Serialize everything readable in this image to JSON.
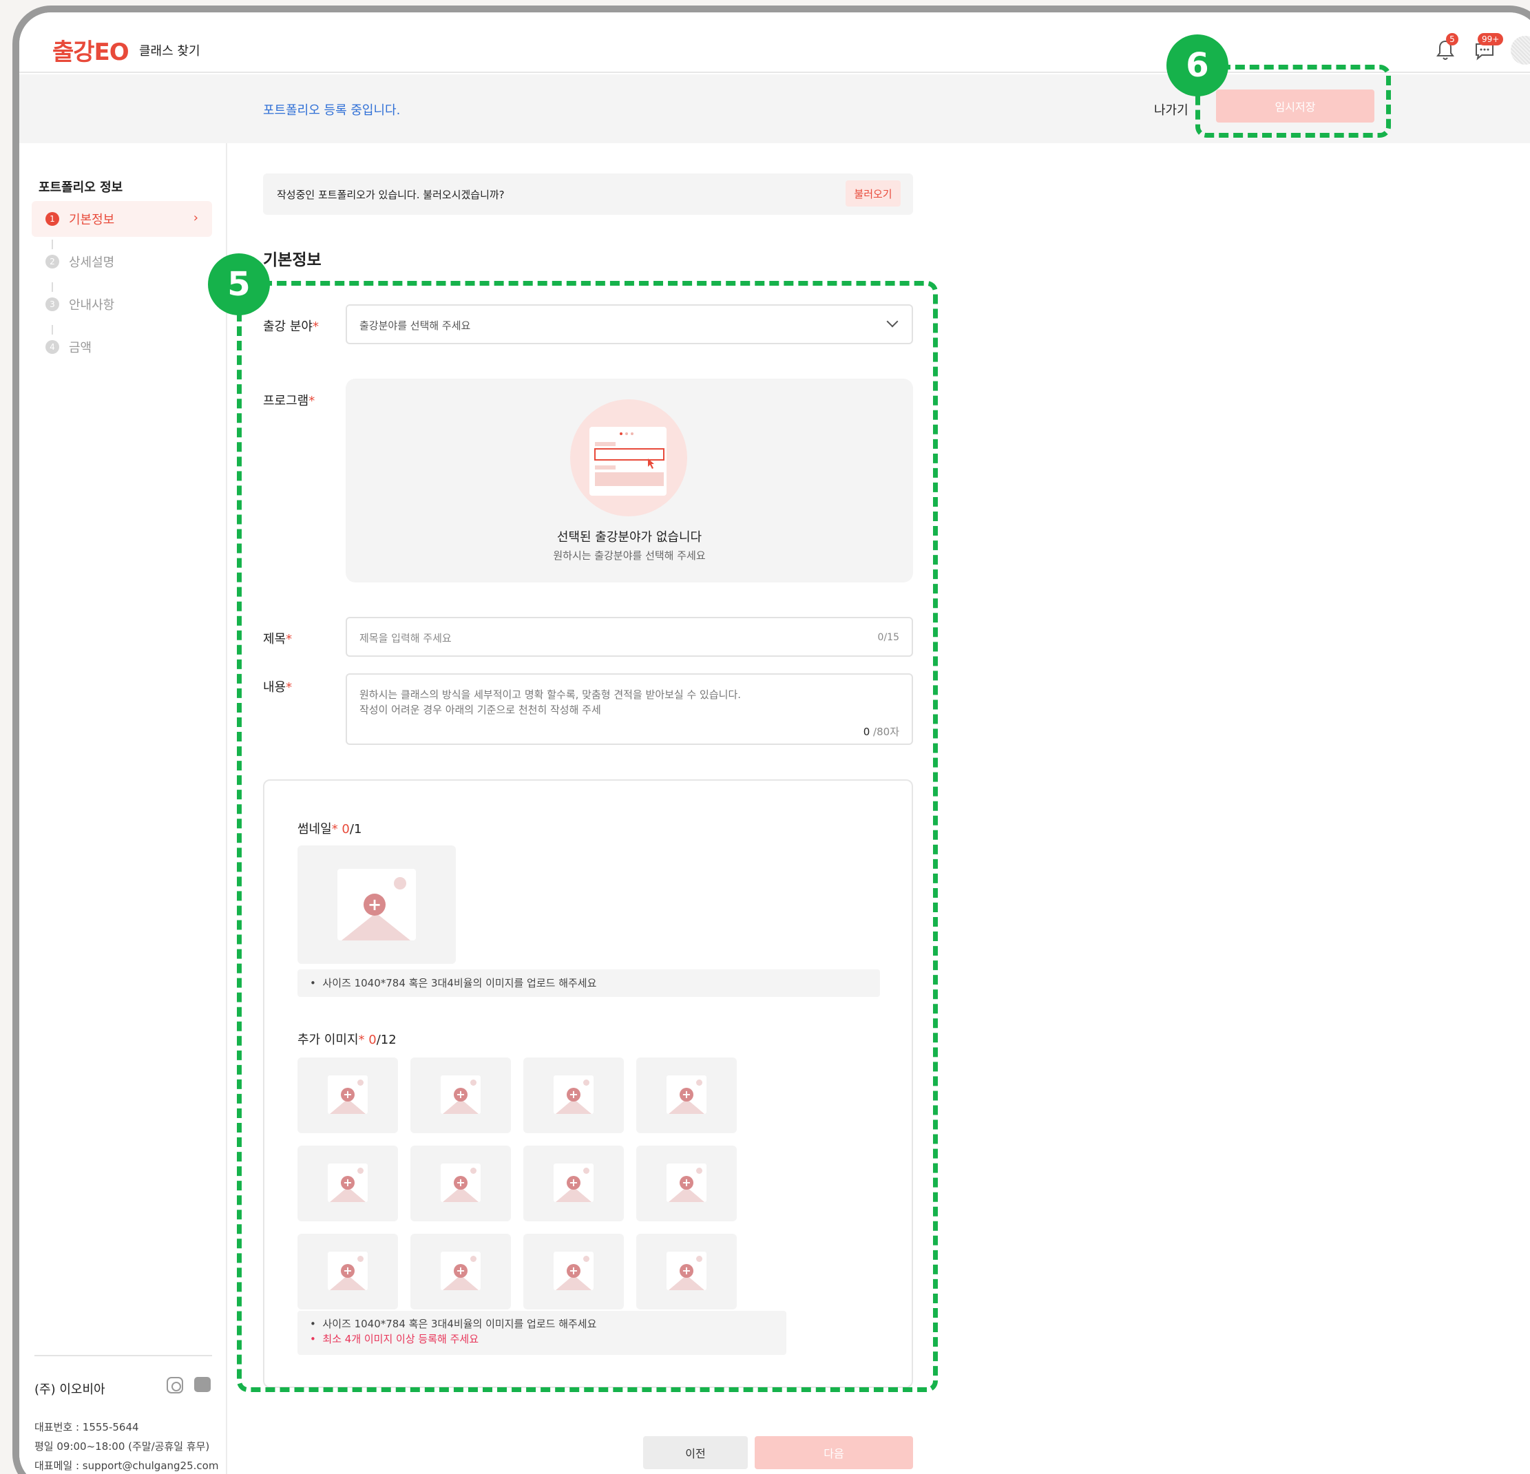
{
  "header": {
    "logo": "출강EO",
    "nav_find": "클래스 찾기",
    "notif_count": "5",
    "chat_count": "99+"
  },
  "status": {
    "text": "포트폴리오 등록 중입니다.",
    "exit": "나가기",
    "temp_save": "임시저장"
  },
  "sidebar": {
    "title": "포트폴리오 정보",
    "steps": [
      {
        "num": "1",
        "label": "기본정보"
      },
      {
        "num": "2",
        "label": "상세설명"
      },
      {
        "num": "3",
        "label": "안내사항"
      },
      {
        "num": "4",
        "label": "금액"
      }
    ],
    "company": "(주) 이오비아",
    "phone": "대표번호 : 1555-5644",
    "hours": "평일 09:00~18:00 (주말/공휴일 휴무)",
    "email": "대표메일 : support@chulgang25.com"
  },
  "main": {
    "load_banner": "작성중인 포트폴리오가 있습니다. 불러오시겠습니까?",
    "load_button": "불러오기",
    "section_title": "기본정보",
    "field_category_label": "출강 분야",
    "field_category_placeholder": "출강분야를 선택해 주세요",
    "field_program_label": "프로그램",
    "program_empty_title": "선택된 출강분야가 없습니다",
    "program_empty_sub": "원하시는 출강분야를 선택해 주세요",
    "field_title_label": "제목",
    "title_placeholder": "제목을 입력해 주세요",
    "title_count": "0/15",
    "field_content_label": "내용",
    "content_placeholder_1": "원하시는 클래스의 방식을 세부적이고 명확 할수록, 맞춤형 견적을 받아보실 수 있습니다.",
    "content_placeholder_2": "작성이 어려운 경우 아래의 기준으로 천천히 작성해 주세",
    "content_count_value": "0",
    "content_count_max": "/80자",
    "required_mark": "*",
    "thumbnail_label": "썸네일",
    "thumbnail_count": "0",
    "thumbnail_max": "/1",
    "thumbnail_note": "사이즈 1040*784 혹은 3대4비율의 이미지를 업로드 해주세요",
    "extra_label": "추가 이미지",
    "extra_count": "0",
    "extra_max": "/12",
    "extra_note_1": "사이즈 1040*784 혹은 3대4비율의 이미지를 업로드 해주세요",
    "extra_note_2": "최소 4개 이미지 이상 등록해 주세요",
    "bullet": "•",
    "prev_button": "이전",
    "next_button": "다음"
  },
  "annotations": {
    "marker_5": "5",
    "marker_6": "6",
    "color": "#16b24b"
  },
  "colors": {
    "brand": "#e84a3a",
    "link": "#2f6fd6",
    "disabled_button": "#fbcac6"
  }
}
